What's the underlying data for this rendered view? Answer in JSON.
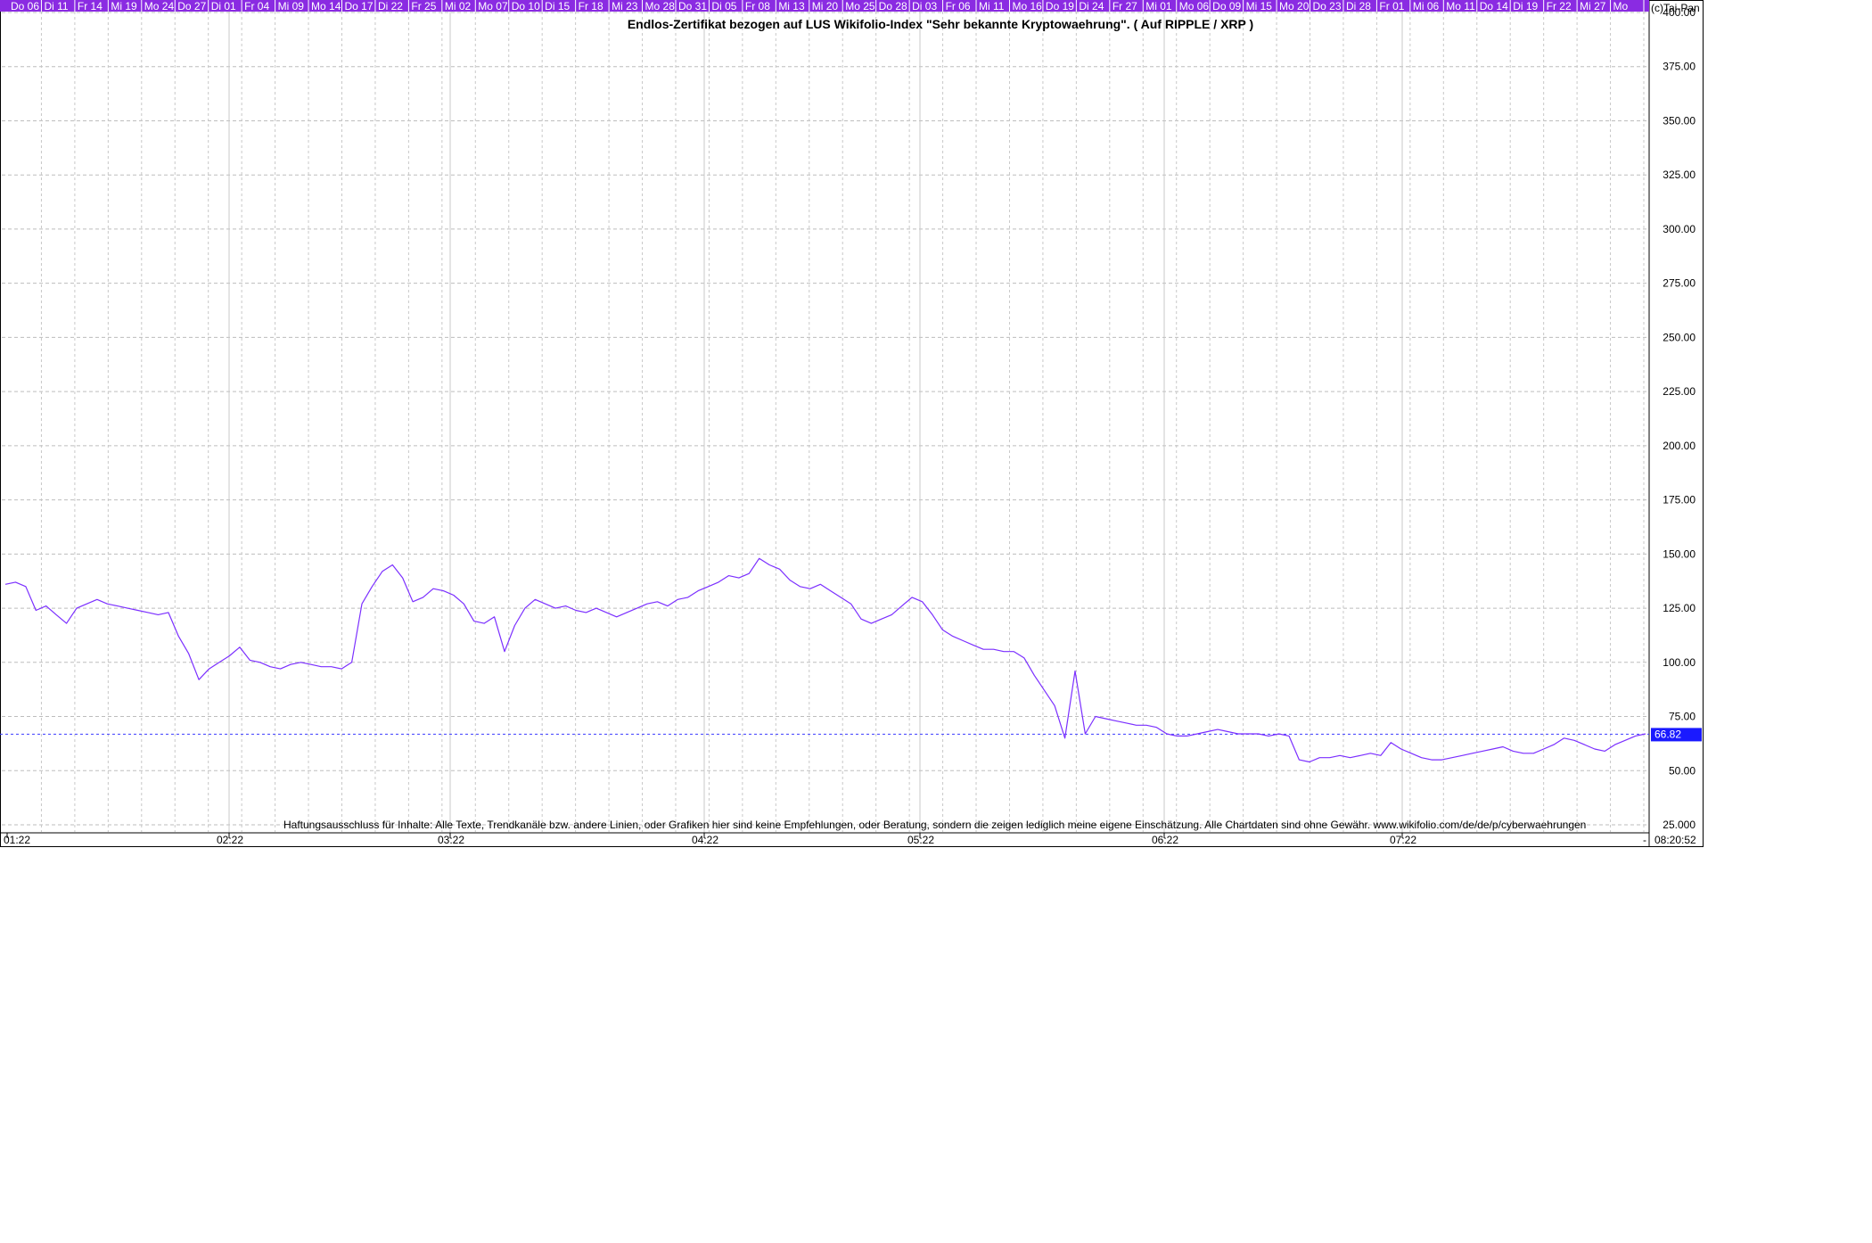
{
  "chart_data": {
    "type": "line",
    "title": "Endlos-Zertifikat bezogen auf LUS Wikifolio-Index \"Sehr bekannte Kryptowaehrung\". ( Auf RIPPLE / XRP )",
    "copyright": "(c)Tai-Pan",
    "disclaimer": "Haftungsausschluss für Inhalte: Alle Texte, Trendkanäle bzw. andere Linien, oder Grafiken hier sind keine Empfehlungen, oder Beratung, sondern die zeigen lediglich meine eigene Einschätzung. Alle Chartdaten sind ohne Gewähr.  www.wikifolio.com/de/de/p/cyberwaehrungen",
    "time_label": "08:20:52",
    "axis_dash": "-",
    "last_value": 66.82,
    "last_value_label": "66.82",
    "ylim": [
      25,
      400
    ],
    "y_ticks": [
      "25.000",
      "50.00",
      "75.00",
      "100.00",
      "125.00",
      "150.00",
      "175.00",
      "200.00",
      "225.00",
      "250.00",
      "275.00",
      "300.00",
      "325.00",
      "350.00",
      "375.00",
      "400.00"
    ],
    "month_ticks": [
      "01:22",
      "02:22",
      "03:22",
      "04:22",
      "05:22",
      "06:22",
      "07:22"
    ],
    "day_ticks": [
      "Do 06",
      "Di  11",
      "Fr  14",
      "Mi  19",
      "Mo 24",
      "Do 27",
      "Di  01",
      "Fr  04",
      "Mi  09",
      "Mo 14",
      "Do 17",
      "Di  22",
      "Fr  25",
      "Mi  02",
      "Mo 07",
      "Do 10",
      "Di  15",
      "Fr  18",
      "Mi  23",
      "Mo 28",
      "Do 31",
      "Di  05",
      "Fr  08",
      "Mi  13",
      "Mi  20",
      "Mo 25",
      "Do 28",
      "Di  03",
      "Fr  06",
      "Mi  11",
      "Mo 16",
      "Do 19",
      "Di  24",
      "Fr  27",
      "Mi  01",
      "Mo 06",
      "Do 09",
      "Mi  15",
      "Mo 20",
      "Do 23",
      "Di  28",
      "Fr  01",
      "Mi  06",
      "Mo 11",
      "Do 14",
      "Di  19",
      "Fr  22",
      "Mi  27",
      "Mo"
    ],
    "series": [
      {
        "color": "#7b2fff",
        "values": [
          136,
          137,
          135,
          124,
          126,
          122,
          118,
          125,
          127,
          129,
          127,
          126,
          125,
          124,
          123,
          122,
          123,
          112,
          104,
          92,
          97,
          100,
          103,
          107,
          101,
          100,
          98,
          97,
          99,
          100,
          99,
          98,
          98,
          97,
          100,
          127,
          135,
          142,
          145,
          139,
          128,
          130,
          134,
          133,
          131,
          127,
          119,
          118,
          121,
          105,
          117,
          125,
          129,
          127,
          125,
          126,
          124,
          123,
          125,
          123,
          121,
          123,
          125,
          127,
          128,
          126,
          129,
          130,
          133,
          135,
          137,
          140,
          139,
          141,
          148,
          145,
          143,
          138,
          135,
          134,
          136,
          133,
          130,
          127,
          120,
          118,
          120,
          122,
          126,
          130,
          128,
          122,
          115,
          112,
          110,
          108,
          106,
          106,
          105,
          105,
          102,
          94,
          87,
          80,
          65,
          96,
          67,
          75,
          74,
          73,
          72,
          71,
          71,
          70,
          67,
          66,
          66,
          67,
          68,
          69,
          68,
          67,
          67,
          67,
          66,
          67,
          66,
          55,
          54,
          56,
          56,
          57,
          56,
          57,
          58,
          57,
          63,
          60,
          58,
          56,
          55,
          55,
          56,
          57,
          58,
          59,
          60,
          61,
          59,
          58,
          58,
          60,
          62,
          65,
          64,
          62,
          60,
          59,
          62,
          64,
          66,
          67
        ]
      }
    ]
  }
}
